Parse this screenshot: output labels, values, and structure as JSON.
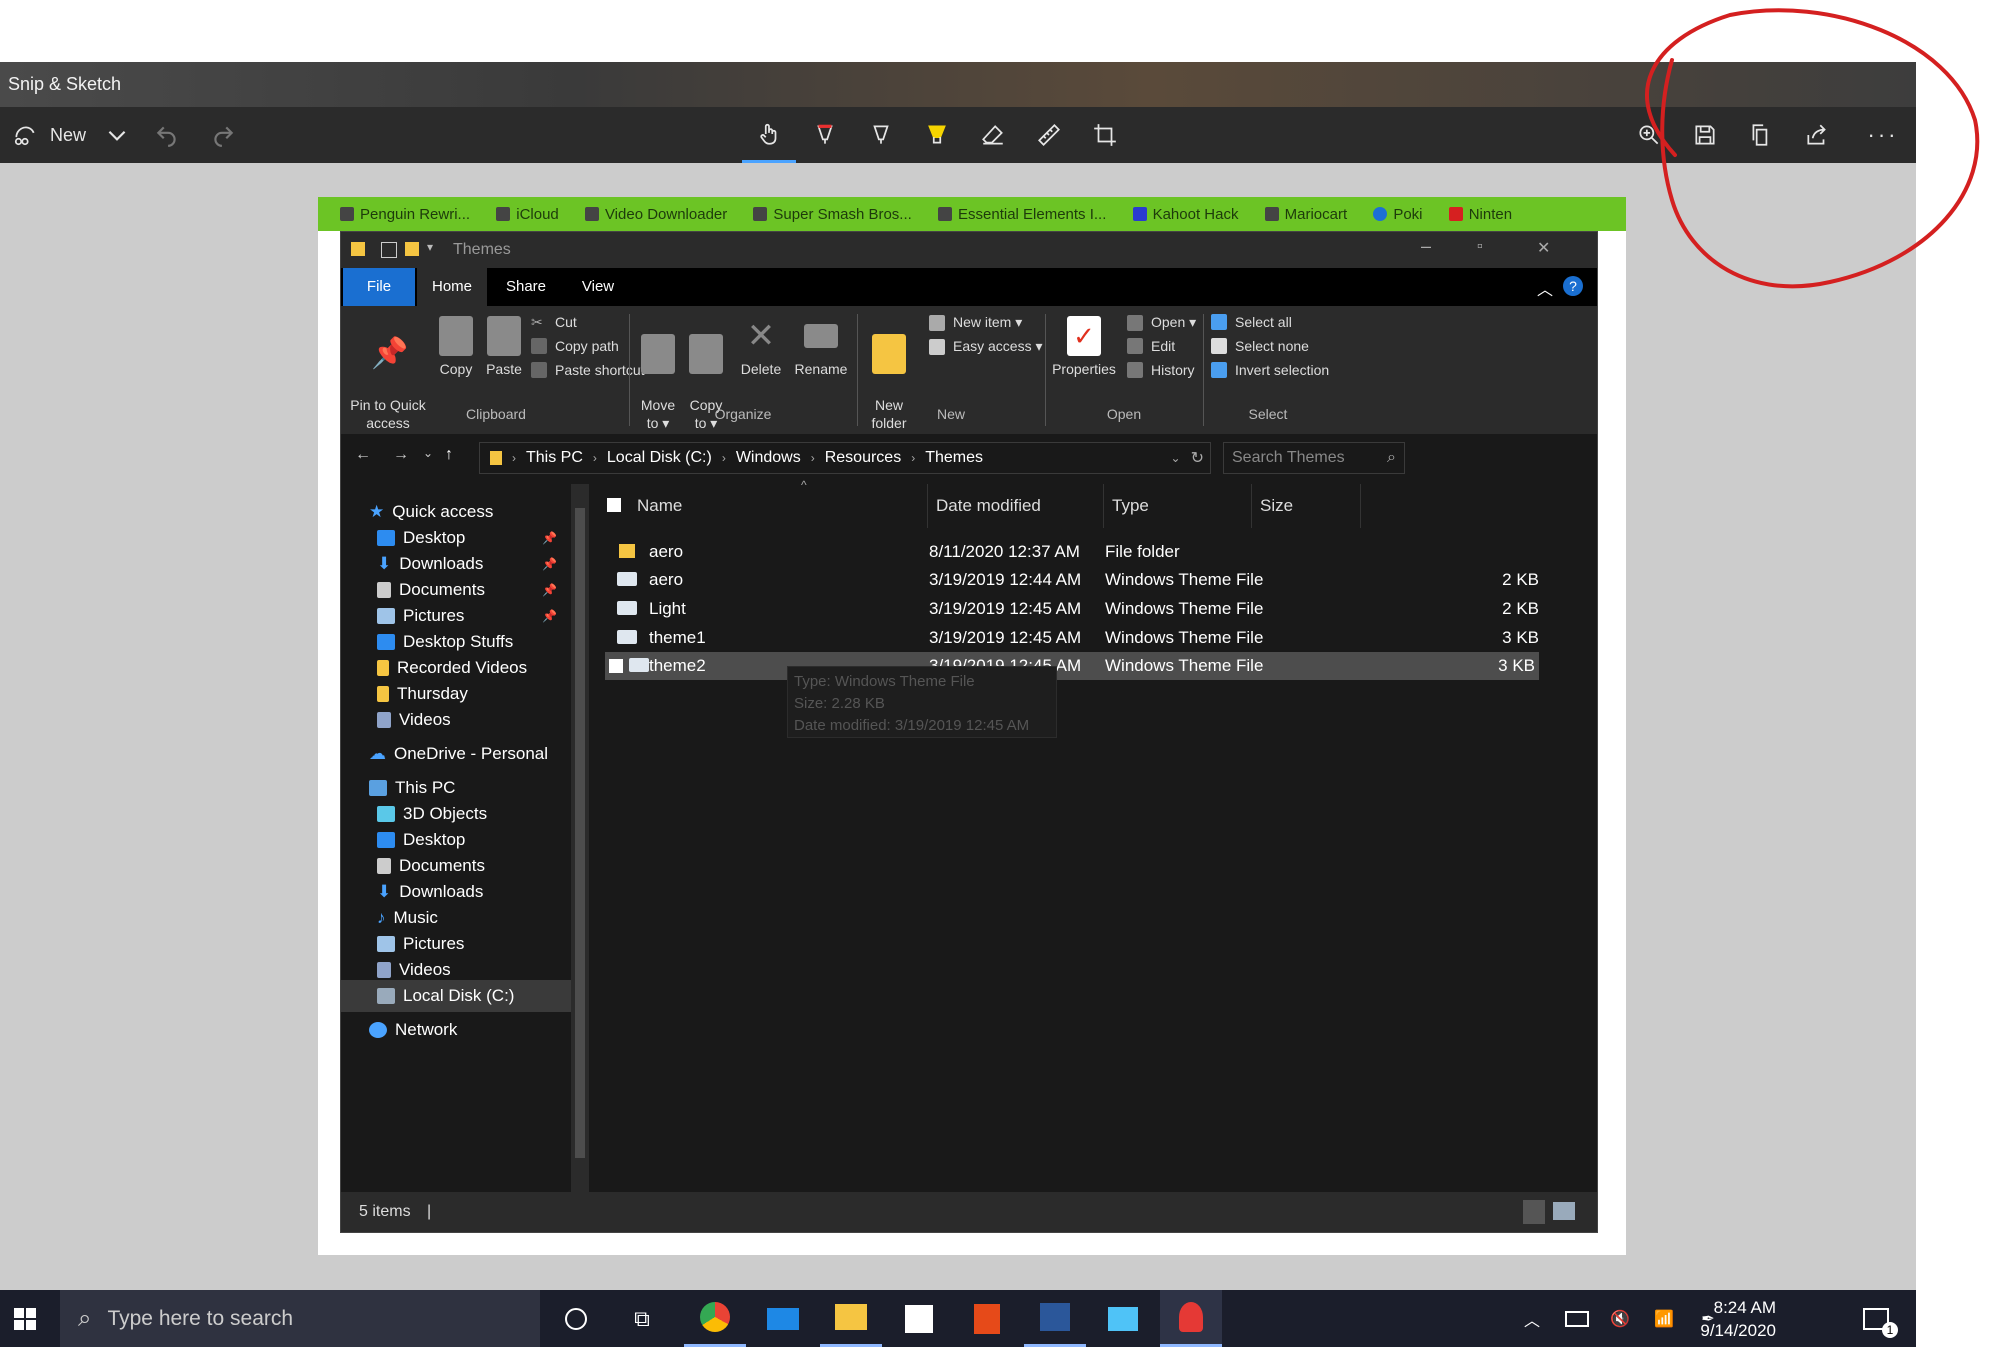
{
  "app": {
    "title": "Snip & Sketch"
  },
  "toolbar": {
    "new_label": "New",
    "icons": [
      "touch-writing-icon",
      "ballpoint-pen-icon",
      "pencil-icon",
      "highlighter-icon",
      "eraser-icon",
      "ruler-icon",
      "crop-icon",
      "zoom-icon",
      "save-icon",
      "copy-icon",
      "share-icon",
      "more-icon"
    ]
  },
  "bookmarks": [
    "Penguin Rewri...",
    "iCloud",
    "Video Downloader",
    "Super Smash Bros...",
    "Essential Elements I...",
    "Kahoot Hack",
    "Mariocart",
    "Poki",
    "Ninten"
  ],
  "explorer": {
    "title": "Themes",
    "tabs": {
      "file": "File",
      "home": "Home",
      "share": "Share",
      "view": "View"
    },
    "ribbon": {
      "pin": "Pin to Quick\naccess",
      "copy": "Copy",
      "paste": "Paste",
      "cut": "Cut",
      "copy_path": "Copy path",
      "paste_shortcut": "Paste shortcut",
      "move_to": "Move\nto ▾",
      "copy_to": "Copy\nto ▾",
      "delete": "Delete",
      "rename": "Rename",
      "new_folder": "New\nfolder",
      "new_item": "New item ▾",
      "easy_access": "Easy access ▾",
      "properties": "Properties",
      "open": "Open ▾",
      "edit": "Edit",
      "history": "History",
      "select_all": "Select all",
      "select_none": "Select none",
      "invert_selection": "Invert selection",
      "groups": {
        "clipboard": "Clipboard",
        "organize": "Organize",
        "new": "New",
        "open": "Open",
        "select": "Select"
      }
    },
    "address": {
      "crumbs": [
        "This PC",
        "Local Disk (C:)",
        "Windows",
        "Resources",
        "Themes"
      ],
      "search_placeholder": "Search Themes"
    },
    "nav": {
      "quick_access": "Quick access",
      "quick_items": [
        "Desktop",
        "Downloads",
        "Documents",
        "Pictures",
        "Desktop Stuffs",
        "Recorded Videos",
        "Thursday",
        "Videos"
      ],
      "onedrive": "OneDrive - Personal",
      "this_pc": "This PC",
      "pc_items": [
        "3D Objects",
        "Desktop",
        "Documents",
        "Downloads",
        "Music",
        "Pictures",
        "Videos",
        "Local Disk (C:)"
      ],
      "network": "Network"
    },
    "columns": {
      "name": "Name",
      "date": "Date modified",
      "type": "Type",
      "size": "Size"
    },
    "files": [
      {
        "name": "aero",
        "date": "8/11/2020 12:37 AM",
        "type": "File folder",
        "size": ""
      },
      {
        "name": "aero",
        "date": "3/19/2019 12:44 AM",
        "type": "Windows Theme File",
        "size": "2 KB"
      },
      {
        "name": "Light",
        "date": "3/19/2019 12:45 AM",
        "type": "Windows Theme File",
        "size": "2 KB"
      },
      {
        "name": "theme1",
        "date": "3/19/2019 12:45 AM",
        "type": "Windows Theme File",
        "size": "3 KB"
      },
      {
        "name": "theme2",
        "date": "3/19/2019 12:45 AM",
        "type": "Windows Theme File",
        "size": "3 KB"
      }
    ],
    "tooltip": {
      "type": "Type: Windows Theme File",
      "size": "Size: 2.28 KB",
      "date": "Date modified: 3/19/2019 12:45 AM"
    },
    "status": "5 items"
  },
  "taskbar": {
    "search_placeholder": "Type here to search",
    "time": "8:24 AM",
    "date": "9/14/2020",
    "notification_count": "1"
  },
  "colors": {
    "annotation": "#d42020",
    "bookmarks_bar": "#6cc425",
    "explorer_bg": "#191919",
    "file_tab": "#1a6fd1"
  }
}
